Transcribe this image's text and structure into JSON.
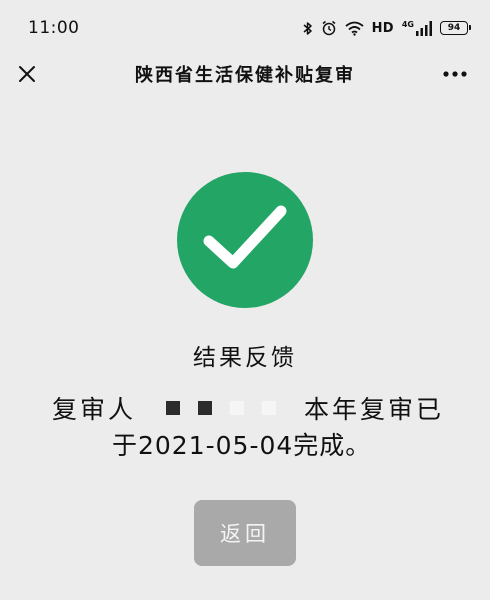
{
  "status_bar": {
    "time": "11:00",
    "network_label": "HD",
    "signal_label": "4G",
    "battery_level": "94",
    "icons": [
      "bluetooth-icon",
      "alarm-icon",
      "wifi-icon",
      "signal-icon",
      "battery-icon"
    ]
  },
  "nav": {
    "title": "陕西省生活保健补贴复审",
    "close_icon": "close-icon",
    "more_icon": "more-icon"
  },
  "result": {
    "icon": "checkmark-icon",
    "icon_color": "#23a566",
    "title": "结果反馈",
    "message_prefix": "复审人",
    "message_suffix": "本年复审已",
    "message_line2": "于2021-05-04完成。"
  },
  "actions": {
    "back_label": "返回",
    "back_button_color": "#a9a9a9"
  }
}
